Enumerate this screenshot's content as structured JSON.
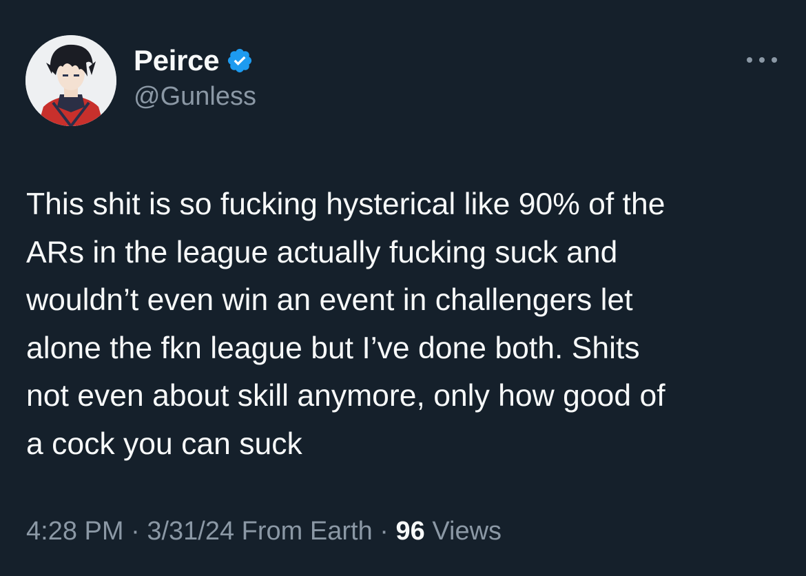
{
  "tweet": {
    "author": {
      "display_name": "Peirce",
      "handle": "@Gunless",
      "verified": true,
      "verified_icon": "verified-badge-icon",
      "avatar_icon": "avatar"
    },
    "more_icon": "more-options-icon",
    "text": "This shit is so fucking hysterical like 90% of the\nARs in the league actually fucking suck and\nwouldn’t even win an event in challengers let\nalone the fkn league but I’ve done both. Shits\nnot even about skill anymore, only how good of\na cock you can suck",
    "meta": {
      "time": "4:28 PM",
      "separator": "·",
      "date": "3/31/24",
      "location": "From Earth",
      "views_count": "96",
      "views_label": "Views"
    }
  },
  "colors": {
    "background": "#15202b",
    "text_primary": "#f7f9f9",
    "text_secondary": "#8b98a5",
    "verified_blue": "#1d9bf0"
  }
}
